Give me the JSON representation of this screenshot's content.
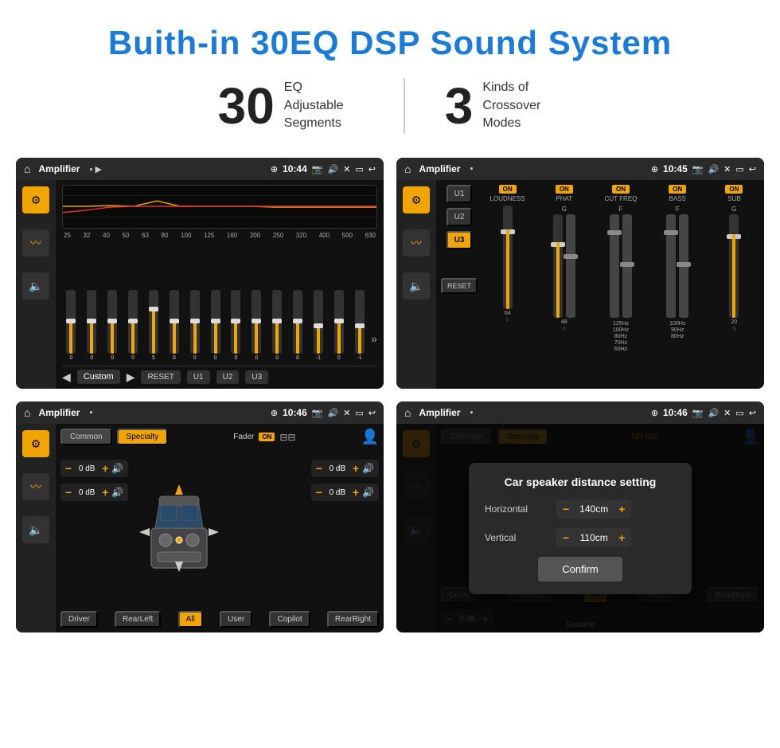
{
  "page": {
    "title": "Buith-in 30EQ DSP Sound System"
  },
  "stats": {
    "eq_number": "30",
    "eq_desc_line1": "EQ Adjustable",
    "eq_desc_line2": "Segments",
    "crossover_number": "3",
    "crossover_desc_line1": "Kinds of",
    "crossover_desc_line2": "Crossover Modes"
  },
  "screen1": {
    "app_name": "Amplifier",
    "time": "10:44",
    "eq_freq_labels": [
      "25",
      "32",
      "40",
      "50",
      "63",
      "80",
      "100",
      "125",
      "160",
      "200",
      "250",
      "320",
      "400",
      "500",
      "630"
    ],
    "eq_values": [
      "0",
      "0",
      "0",
      "0",
      "5",
      "0",
      "0",
      "0",
      "0",
      "0",
      "0",
      "0",
      "-1",
      "0",
      "-1"
    ],
    "bottom_buttons": [
      "RESET",
      "U1",
      "U2",
      "U3"
    ],
    "preset_label": "Custom"
  },
  "screen2": {
    "app_name": "Amplifier",
    "time": "10:45",
    "channels": [
      "LOUDNESS",
      "PHAT",
      "CUT FREQ",
      "BASS",
      "SUB"
    ],
    "u_buttons": [
      "U1",
      "U2",
      "U3"
    ],
    "reset_label": "RESET"
  },
  "screen3": {
    "app_name": "Amplifier",
    "time": "10:46",
    "top_buttons": [
      "Common",
      "Specialty"
    ],
    "fader_label": "Fader",
    "fader_on": "ON",
    "db_values": [
      "0 dB",
      "0 dB",
      "0 dB",
      "0 dB"
    ],
    "bottom_buttons": [
      "Driver",
      "RearLeft",
      "All",
      "User",
      "Copilot",
      "RearRight"
    ]
  },
  "screen4": {
    "app_name": "Amplifier",
    "time": "10:46",
    "dialog": {
      "title": "Car speaker distance setting",
      "horizontal_label": "Horizontal",
      "horizontal_value": "140cm",
      "vertical_label": "Vertical",
      "vertical_value": "110cm",
      "confirm_label": "Confirm"
    },
    "bottom_buttons": [
      "Driver",
      "RearLeft",
      "All",
      "Copilot",
      "RearRight"
    ]
  },
  "watermark": "Seicane"
}
